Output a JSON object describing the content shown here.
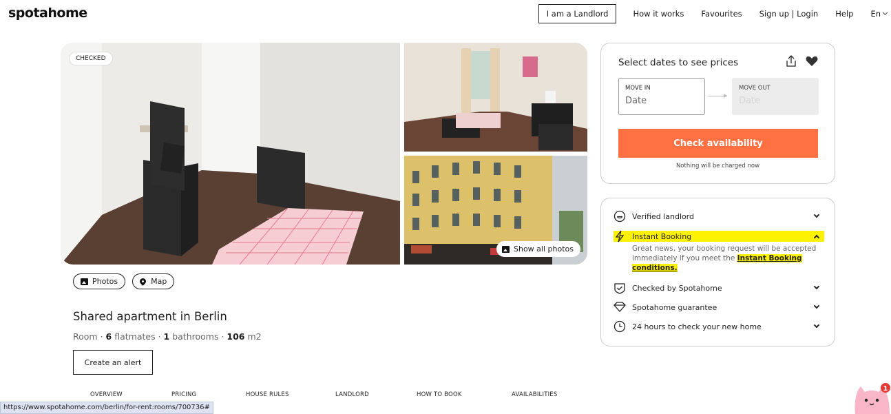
{
  "header": {
    "logo": "spotahome",
    "landlord_button": "I am a Landlord",
    "nav": [
      "How it works",
      "Favourites",
      "Sign up | Login",
      "Help",
      "En"
    ]
  },
  "gallery": {
    "badge": "CHECKED",
    "show_all_label": "Show all photos"
  },
  "pills": {
    "photos": "Photos",
    "map": "Map"
  },
  "listing": {
    "title": "Shared apartment in Berlin",
    "type": "Room",
    "sep": " · ",
    "flatmates_count": "6",
    "flatmates_label": "flatmates",
    "bathrooms_count": "1",
    "bathrooms_label": "bathrooms",
    "size": "106",
    "size_unit": "m2",
    "alert_button": "Create an alert"
  },
  "tabs": [
    "OVERVIEW",
    "PRICING",
    "HOUSE RULES",
    "LANDLORD",
    "HOW TO BOOK",
    "AVAILABILITIES"
  ],
  "status_url": "https://www.spotahome.com/berlin/for-rent:rooms/700736#",
  "booking": {
    "title": "Select dates to see prices",
    "move_in_label": "MOVE IN",
    "move_in_value": "Date",
    "move_out_label": "MOVE OUT",
    "move_out_value": "Date",
    "check_button": "Check availability",
    "note": "Nothing will be charged now"
  },
  "features": {
    "verified": "Verified landlord",
    "instant": "Instant Booking",
    "instant_desc": "Great news, your booking request will be accepted immediately if you meet the",
    "instant_link": "Instant Booking conditions.",
    "checked": "Checked by Spotahome",
    "guarantee": "Spotahome guarantee",
    "hours": "24 hours to check your new home"
  },
  "notification_count": "1",
  "colors": {
    "accent": "#ff7043",
    "highlight": "#fff200",
    "notification": "#e53935"
  }
}
